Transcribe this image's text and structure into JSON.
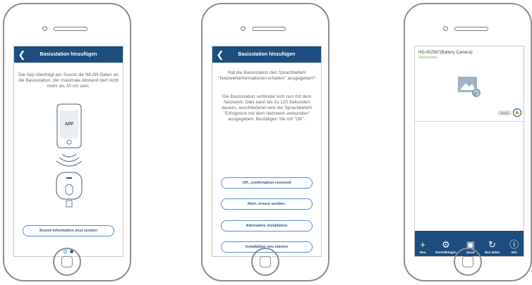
{
  "phone1": {
    "title": "Basisstation hinzufügen",
    "instruction": "Die App überträgt per Sound die WLAN Daten an die Basisstation, der maximale Abstand darf nicht mehr als 30 cm sein.",
    "app_label": "APP",
    "send_button": "Sound information jetzt senden"
  },
  "phone2": {
    "title": "Basisstation hinzufügen",
    "question": "Hat die Basisstation den Sprachbefehl \"Netzwerkinformationen erhalten\" ausgegeben?",
    "info": "Die Basisstation verbindet sich nun mit dem Netzwerk. Dies kann bis zu 120 Sekunden dauern, anschließend wird der Sprachbefehl \"Erfolgreich mit dem Netzwerk verbunden\" ausgegeben. Bestätigen Sie mit \"OK\".",
    "buttons": [
      "OK, confirmation received",
      "Nein, erneut senden.",
      "Alternative installation",
      "Installation neu starten"
    ]
  },
  "phone3": {
    "device_name": "HD-002587(Battery Camera)",
    "status": "Verbunden",
    "alerts_label": "Alerts",
    "tabs": [
      {
        "icon": "+",
        "label": "Neu"
      },
      {
        "icon": "⚙",
        "label": "Einstellungen"
      },
      {
        "icon": "▣",
        "label": "Quad"
      },
      {
        "icon": "↻",
        "label": "Neu laden"
      },
      {
        "icon": "ⓘ",
        "label": "Info"
      }
    ]
  },
  "colors": {
    "nav": "#1c4d7e",
    "accent": "#4a90d9",
    "status_green": "#6abf40"
  }
}
